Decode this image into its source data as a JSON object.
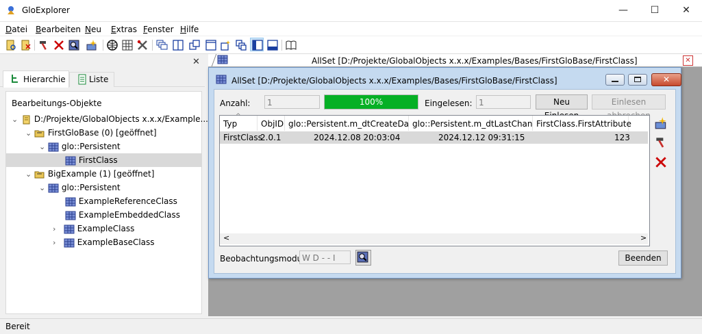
{
  "window": {
    "title": "GloExplorer",
    "minimize": "—",
    "maximize": "☐",
    "close": "✕"
  },
  "menu": [
    {
      "label": "Datei",
      "key": "D",
      "rest": "atei"
    },
    {
      "label": "Bearbeiten",
      "key": "B",
      "rest": "earbeiten"
    },
    {
      "label": "Neu",
      "key": "N",
      "rest": "eu"
    },
    {
      "label": "Extras",
      "key": "E",
      "rest": "xtras"
    },
    {
      "label": "Fenster",
      "key": "F",
      "rest": "enster"
    },
    {
      "label": "Hilfe",
      "key": "H",
      "rest": "ilfe"
    }
  ],
  "toolbar_icons": [
    "open-base-icon",
    "close-base-icon",
    "hammer-icon",
    "delete-icon",
    "zoom-icon",
    "new-object-icon",
    "globe-icon",
    "grid-icon",
    "tools-icon",
    "cascade-icon",
    "tile-vertical-icon",
    "tile-icon",
    "window-icon",
    "window-new-icon",
    "windows-icon",
    "panel-left-icon",
    "panel-bottom-icon",
    "book-icon"
  ],
  "left": {
    "close": "✕",
    "tabs": [
      {
        "label": "Hierarchie"
      },
      {
        "label": "Liste"
      }
    ],
    "section_title": "Bearbeitungs-Objekte",
    "tree": [
      {
        "label": "D:/Projekte/GlobalObjects x.x.x/Example...",
        "level": 0,
        "chevron": "expanded",
        "icon": "base-icon"
      },
      {
        "label": "FirstGloBase (0) [geöffnet]",
        "level": 1,
        "chevron": "expanded",
        "icon": "folder-open-icon"
      },
      {
        "label": "glo::Persistent",
        "level": 2,
        "chevron": "expanded",
        "icon": "class-icon"
      },
      {
        "label": "FirstClass",
        "level": 3,
        "chevron": "none",
        "icon": "class-icon",
        "selected": true
      },
      {
        "label": "BigExample (1) [geöffnet]",
        "level": 1,
        "chevron": "expanded",
        "icon": "folder-open-icon"
      },
      {
        "label": "glo::Persistent",
        "level": 2,
        "chevron": "expanded",
        "icon": "class-icon"
      },
      {
        "label": "ExampleReferenceClass",
        "level": 3,
        "chevron": "none",
        "icon": "class-icon"
      },
      {
        "label": "ExampleEmbeddedClass",
        "level": 3,
        "chevron": "none",
        "icon": "class-icon"
      },
      {
        "label": "ExampleClass",
        "level": 3,
        "chevron": "collapsed",
        "icon": "class-icon"
      },
      {
        "label": "ExampleBaseClass",
        "level": 3,
        "chevron": "collapsed",
        "icon": "class-icon"
      }
    ]
  },
  "doc_tab": {
    "title": "AllSet [D:/Projekte/GlobalObjects x.x.x/Examples/Bases/FirstGloBase/FirstClass]",
    "close": "✕"
  },
  "child": {
    "title": "AllSet [D:/Projekte/GlobalObjects x.x.x/Examples/Bases/FirstGloBase/FirstClass]",
    "anzahl_label": "Anzahl:",
    "anzahl_value": "1",
    "progress_text": "100%",
    "progress_percent": 100,
    "eingelesen_label": "Eingelesen:",
    "eingelesen_value": "1",
    "reload_button": "Neu Einlesen",
    "cancel_button": "Einlesen abbrechen",
    "columns": [
      "Typ",
      "ObjID",
      "glo::Persistent.m_dtCreateDate",
      "glo::Persistent.m_dtLastChange",
      "FirstClass.FirstAttribute"
    ],
    "rows": [
      [
        "FirstClass",
        "2.0.1",
        "2024.12.08 20:03:04",
        "2024.12.12 09:31:15",
        "123"
      ]
    ],
    "mode_label": "Beobachtungsmodu:",
    "mode_value": "W D - - I",
    "end_button": "Beenden",
    "scroll_left": "<",
    "scroll_right": ">"
  },
  "status": {
    "text": "Bereit"
  }
}
